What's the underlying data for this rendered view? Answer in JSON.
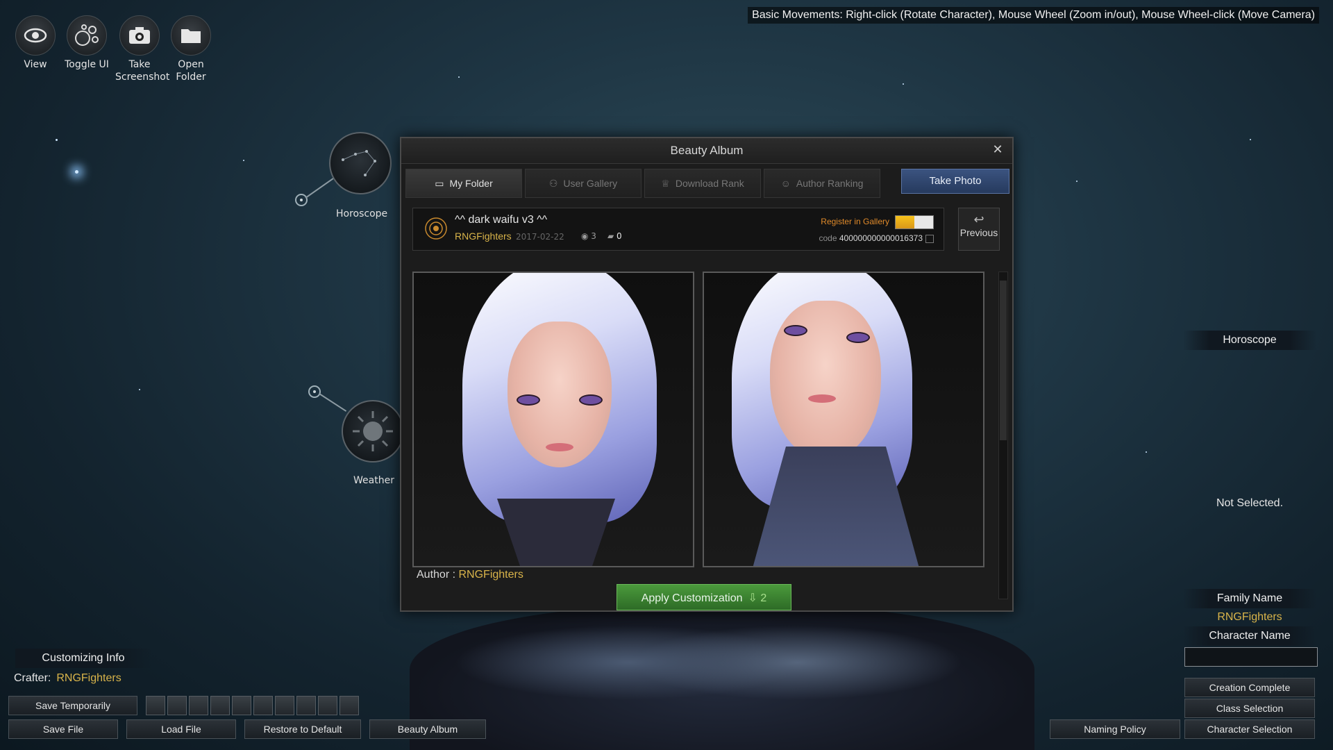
{
  "hint": "Basic Movements: Right-click (Rotate Character), Mouse Wheel (Zoom in/out), Mouse Wheel-click (Move Camera)",
  "toolbar": [
    {
      "label": "View",
      "icon": "eye-icon"
    },
    {
      "label": "Toggle UI",
      "icon": "circles-icon"
    },
    {
      "label": "Take Screenshot",
      "icon": "camera-icon"
    },
    {
      "label": "Open Folder",
      "icon": "folder-icon"
    }
  ],
  "nodes": {
    "horoscope": "Horoscope",
    "weather": "Weather"
  },
  "dialog": {
    "title": "Beauty Album",
    "tabs": [
      {
        "label": "My Folder",
        "active": true
      },
      {
        "label": "User Gallery",
        "active": false
      },
      {
        "label": "Download Rank",
        "active": false
      },
      {
        "label": "Author Ranking",
        "active": false
      }
    ],
    "take_photo": "Take Photo",
    "entry": {
      "title": "^^ dark waifu v3 ^^",
      "author": "RNGFighters",
      "date": "2017-02-22",
      "views": "3",
      "comments": "0",
      "register_label": "Register in Gallery",
      "register_fill": 0.5,
      "code_label": "code",
      "code": "400000000000016373"
    },
    "previous": "Previous",
    "author_label": "Author :",
    "author_name": "RNGFighters",
    "apply_label": "Apply Customization",
    "apply_count": "2"
  },
  "right_panel": {
    "horoscope_title": "Horoscope",
    "horoscope_value": "Not Selected.",
    "family_name_title": "Family Name",
    "family_name": "RNGFighters",
    "character_name_title": "Character Name",
    "character_name_value": "",
    "creation_complete": "Creation Complete",
    "class_selection": "Class Selection",
    "character_selection": "Character Selection",
    "naming_policy": "Naming Policy"
  },
  "bottom_left": {
    "customizing_info": "Customizing Info",
    "crafter_label": "Crafter:",
    "crafter_name": "RNGFighters",
    "save_temporarily": "Save Temporarily",
    "save_file": "Save File",
    "load_file": "Load File",
    "restore_default": "Restore to Default",
    "beauty_album": "Beauty Album"
  },
  "colors": {
    "accent_gold": "#d9b44a",
    "button_green": "#3f8a33",
    "take_photo_blue": "#2f4670",
    "register_orange": "#e08a2a"
  }
}
